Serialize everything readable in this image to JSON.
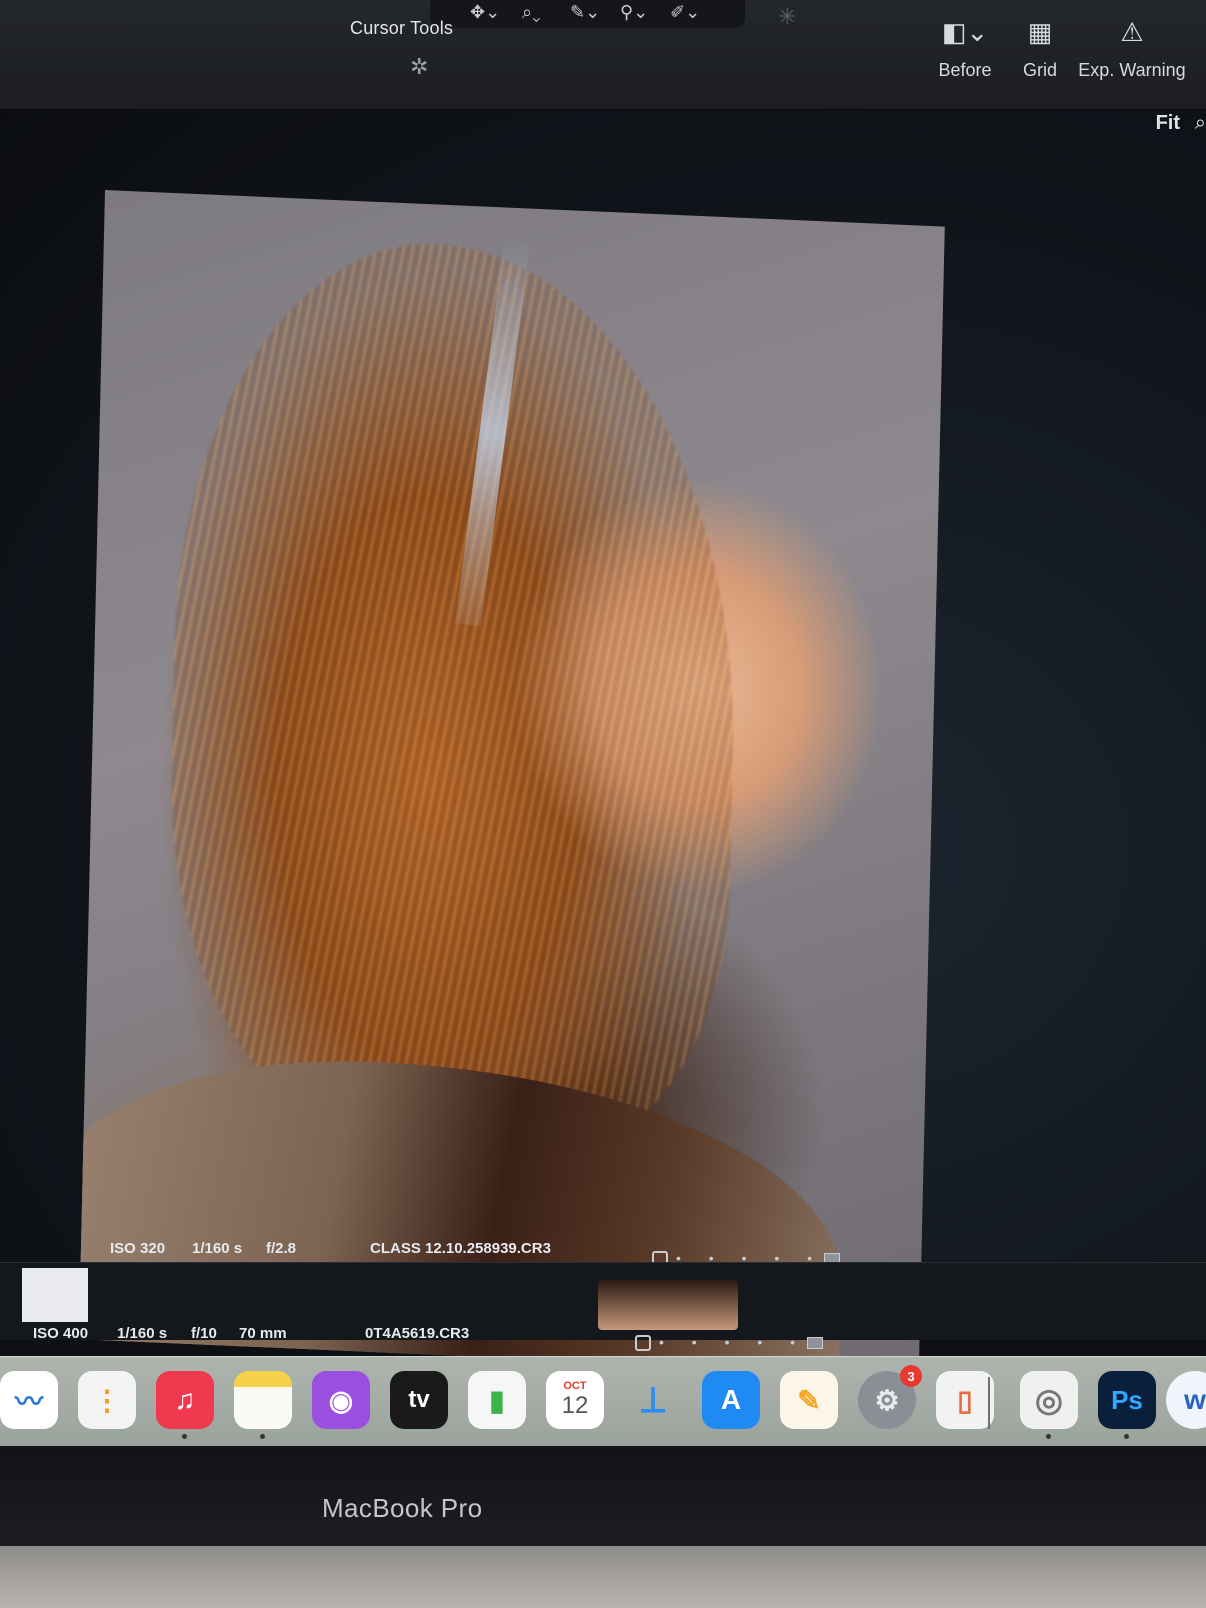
{
  "toolbar": {
    "cursor_tools_label": "Cursor Tools",
    "before_label": "Before",
    "grid_label": "Grid",
    "exp_warning_label": "Exp. Warning",
    "fit_label": "Fit"
  },
  "viewer": {
    "current": {
      "iso": "ISO 320",
      "shutter": "1/160 s",
      "aperture": "f/2.8",
      "filename": "CLASS 12.10.258939.CR3"
    },
    "next": {
      "iso": "ISO 400",
      "shutter": "1/160 s",
      "aperture": "f/10",
      "focal_length": "70 mm",
      "filename": "0T4A5619.CR3"
    }
  },
  "dock": {
    "apps": [
      {
        "name": "freeform",
        "glyph": "〰",
        "color": "#ffffff"
      },
      {
        "name": "reminders",
        "glyph": "⋮",
        "color": "#f4f4f4"
      },
      {
        "name": "music",
        "glyph": "♫",
        "color": "#f0394f"
      },
      {
        "name": "notes",
        "glyph": "",
        "color": "#fbfbf5"
      },
      {
        "name": "podcasts",
        "glyph": "◉",
        "color": "#9b4fe0"
      },
      {
        "name": "apple-tv",
        "glyph": "tv",
        "color": "#1a1a1a"
      },
      {
        "name": "numbers",
        "glyph": "▮",
        "color": "#f6f6f6"
      },
      {
        "name": "calendar",
        "glyph": "12",
        "color": "#ffffff"
      },
      {
        "name": "keynote",
        "glyph": "⟂",
        "color": "#2f8cf2"
      },
      {
        "name": "app-store",
        "glyph": "A",
        "color": "#1f8af2"
      },
      {
        "name": "pages",
        "glyph": "✎",
        "color": "#f5a623"
      },
      {
        "name": "system-settings",
        "glyph": "⚙",
        "color": "#8a8f95"
      },
      {
        "name": "iphone-mirroring",
        "glyph": "▯",
        "color": "#f2f2f2"
      },
      {
        "name": "capture-one",
        "glyph": "◎",
        "color": "#f0f0f0"
      },
      {
        "name": "photoshop",
        "glyph": "Ps",
        "color": "#0a1f3b"
      },
      {
        "name": "word",
        "glyph": "w",
        "color": "#f0f4fb"
      }
    ],
    "calendar_month": "OCT",
    "calendar_day": "12",
    "settings_badge": "3"
  },
  "bezel": {
    "model_label": "MacBook Pro"
  }
}
